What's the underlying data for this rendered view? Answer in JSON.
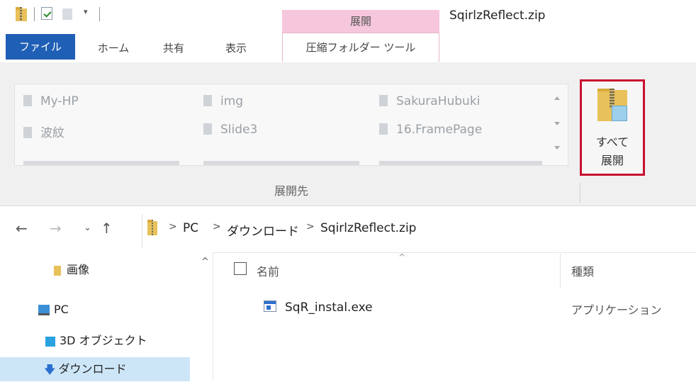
{
  "window": {
    "title": "SqirlzReflect.zip",
    "context_tab_group": "展開"
  },
  "tabs": {
    "file": "ファイル",
    "home": "ホーム",
    "share": "共有",
    "view": "表示",
    "compressed_tools": "圧縮フォルダー ツール"
  },
  "ribbon": {
    "destinations": [
      {
        "label": "My-HP"
      },
      {
        "label": "img"
      },
      {
        "label": "SakuraHubuki"
      },
      {
        "label": "波紋"
      },
      {
        "label": "Slide3"
      },
      {
        "label": "16.FramePage"
      }
    ],
    "group_label": "展開先",
    "extract_all_line1": "すべて",
    "extract_all_line2": "展開"
  },
  "address": {
    "crumbs": [
      "PC",
      "ダウンロード",
      "SqirlzReflect.zip"
    ]
  },
  "nav_pane": {
    "items": [
      {
        "label": "画像"
      },
      {
        "label": "PC"
      },
      {
        "label": "3D オブジェクト"
      },
      {
        "label": "ダウンロード"
      }
    ]
  },
  "file_list": {
    "col_name": "名前",
    "col_type": "種類",
    "rows": [
      {
        "name": "SqR_instal.exe",
        "type": "アプリケーション"
      }
    ]
  },
  "colors": {
    "file_tab": "#1f5fb5",
    "context_tab": "#f6c6dc",
    "highlight_border": "#c8102e",
    "selected_nav": "#cde6f7"
  }
}
